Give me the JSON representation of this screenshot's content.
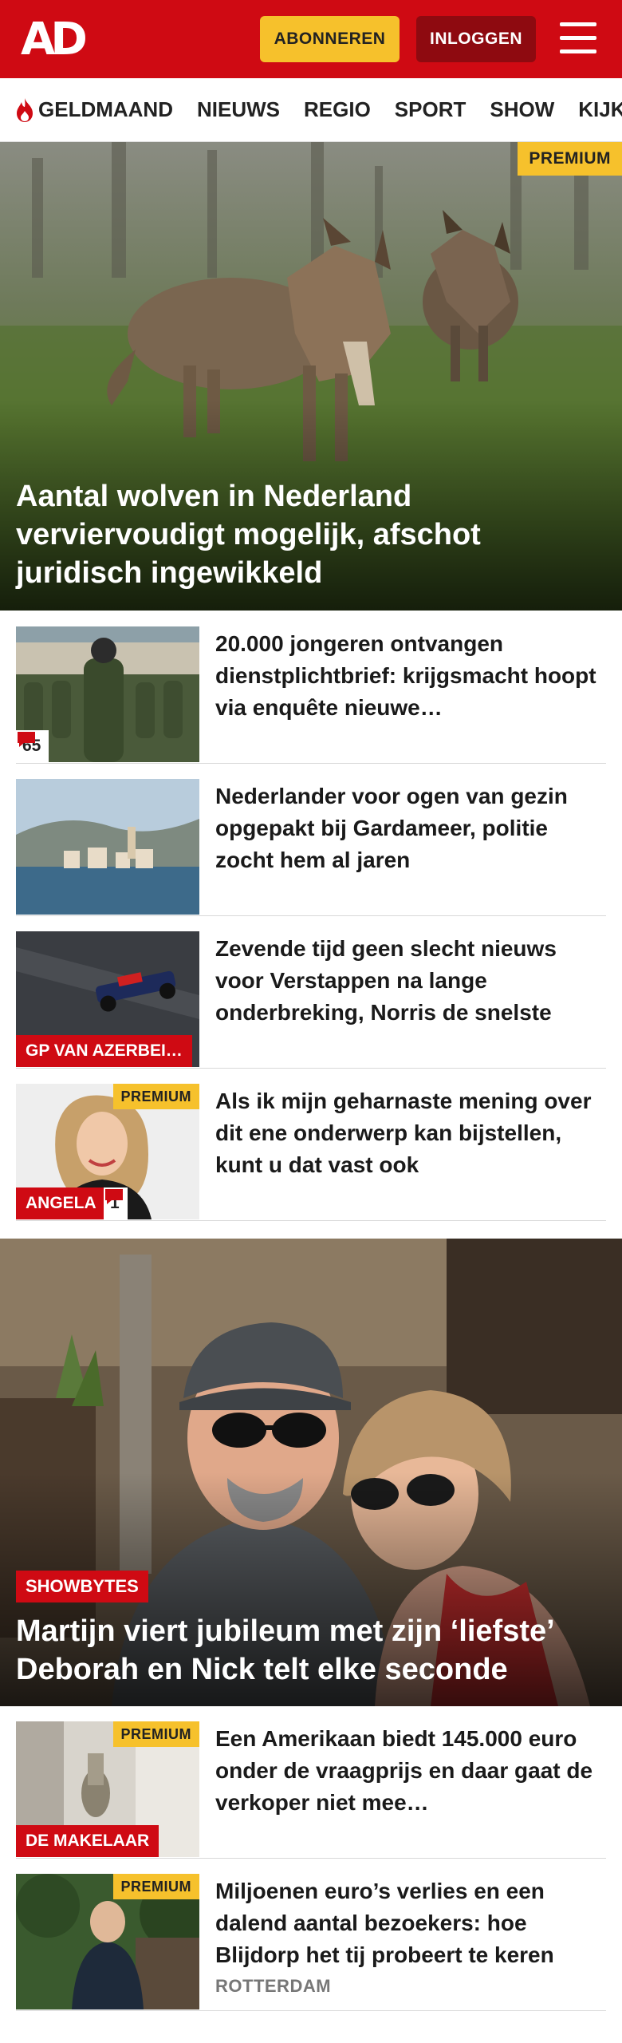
{
  "header": {
    "logo": "AD",
    "subscribe_label": "ABONNEREN",
    "login_label": "INLOGGEN",
    "menu_icon": "hamburger-menu-icon",
    "brand_color": "#cf0a13"
  },
  "nav": {
    "items": [
      {
        "label": "GELDMAAND",
        "icon": "flame-icon"
      },
      {
        "label": "NIEUWS"
      },
      {
        "label": "REGIO"
      },
      {
        "label": "SPORT"
      },
      {
        "label": "SHOW"
      },
      {
        "label": "KIJK"
      }
    ]
  },
  "hero1": {
    "badge": "PREMIUM",
    "title": "Aantal wolven in Nederland verviervoudigt mogelijk, afschot juridisch ingewikkeld"
  },
  "articles1": [
    {
      "title": "20.000 jongeren ontvangen dienstplichtbrief: krijgsmacht hoopt via enquête nieuwe…",
      "comments": "65"
    },
    {
      "title": "Nederlander voor ogen van gezin opgepakt bij Gardameer, politie zocht hem al jaren"
    },
    {
      "title": "Zevende tijd geen slecht nieuws voor Verstappen na lange onderbreking, Norris de snelste",
      "label": "GP VAN AZERBEI…"
    },
    {
      "title": "Als ik mijn geharnaste mening over dit ene onderwerp kan bijstellen, kunt u dat vast ook",
      "label": "ANGELA",
      "comments": "1",
      "badge": "PREMIUM"
    }
  ],
  "hero2": {
    "label": "SHOWBYTES",
    "title": "Martijn viert jubileum met zijn ‘liefste’ Deborah en Nick telt elke seconde"
  },
  "articles2": [
    {
      "title": "Een Amerikaan biedt 145.000 euro onder de vraagprijs en daar gaat de verkoper niet mee…",
      "label": "DE MAKELAAR",
      "badge": "PREMIUM"
    },
    {
      "title": "Miljoenen euro’s verlies en een dalend aantal bezoekers: hoe Blijdorp het tij probeert te keren",
      "sub": "ROTTERDAM",
      "badge": "PREMIUM"
    }
  ]
}
